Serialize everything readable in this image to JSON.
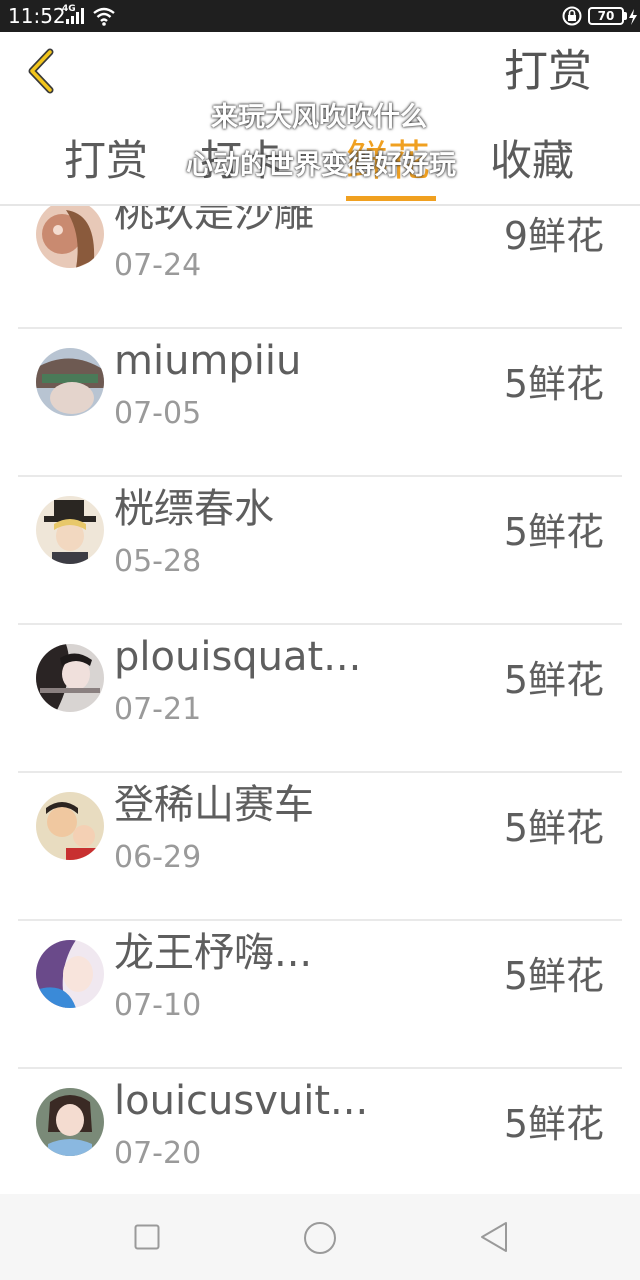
{
  "status_bar": {
    "time": "11:52",
    "network": "4G",
    "battery_level": "70",
    "icons": [
      "signal-icon",
      "wifi-icon",
      "lock-icon",
      "battery-icon",
      "charging-icon"
    ]
  },
  "header": {
    "back_icon": "chevron-left-icon",
    "right_action": "打赏"
  },
  "overlay": {
    "line1": "来玩大风吹吹什么",
    "line2": "心动的世界变得好好玩"
  },
  "tabs": [
    {
      "label": "打赏",
      "active": false
    },
    {
      "label": "打卡",
      "active": false
    },
    {
      "label": "鲜花",
      "active": true
    },
    {
      "label": "收藏",
      "active": false
    }
  ],
  "colors": {
    "accent": "#f0a020",
    "text_primary": "#5e5e5e",
    "text_secondary": "#9a9a9a"
  },
  "list": [
    {
      "name": "桃玖是沙雕",
      "date": "07-24",
      "count": "9鲜花"
    },
    {
      "name": "miumpiiu",
      "date": "07-05",
      "count": "5鲜花"
    },
    {
      "name": "桄缥春水",
      "date": "05-28",
      "count": "5鲜花"
    },
    {
      "name": "plouisquat...",
      "date": "07-21",
      "count": "5鲜花"
    },
    {
      "name": "登稀山赛车",
      "date": "06-29",
      "count": "5鲜花"
    },
    {
      "name": "龙王杼嗨...",
      "date": "07-10",
      "count": "5鲜花"
    },
    {
      "name": "louicusvuit...",
      "date": "07-20",
      "count": "5鲜花"
    }
  ],
  "nav": {
    "icons": [
      "recent-apps-icon",
      "home-icon",
      "back-icon"
    ]
  }
}
